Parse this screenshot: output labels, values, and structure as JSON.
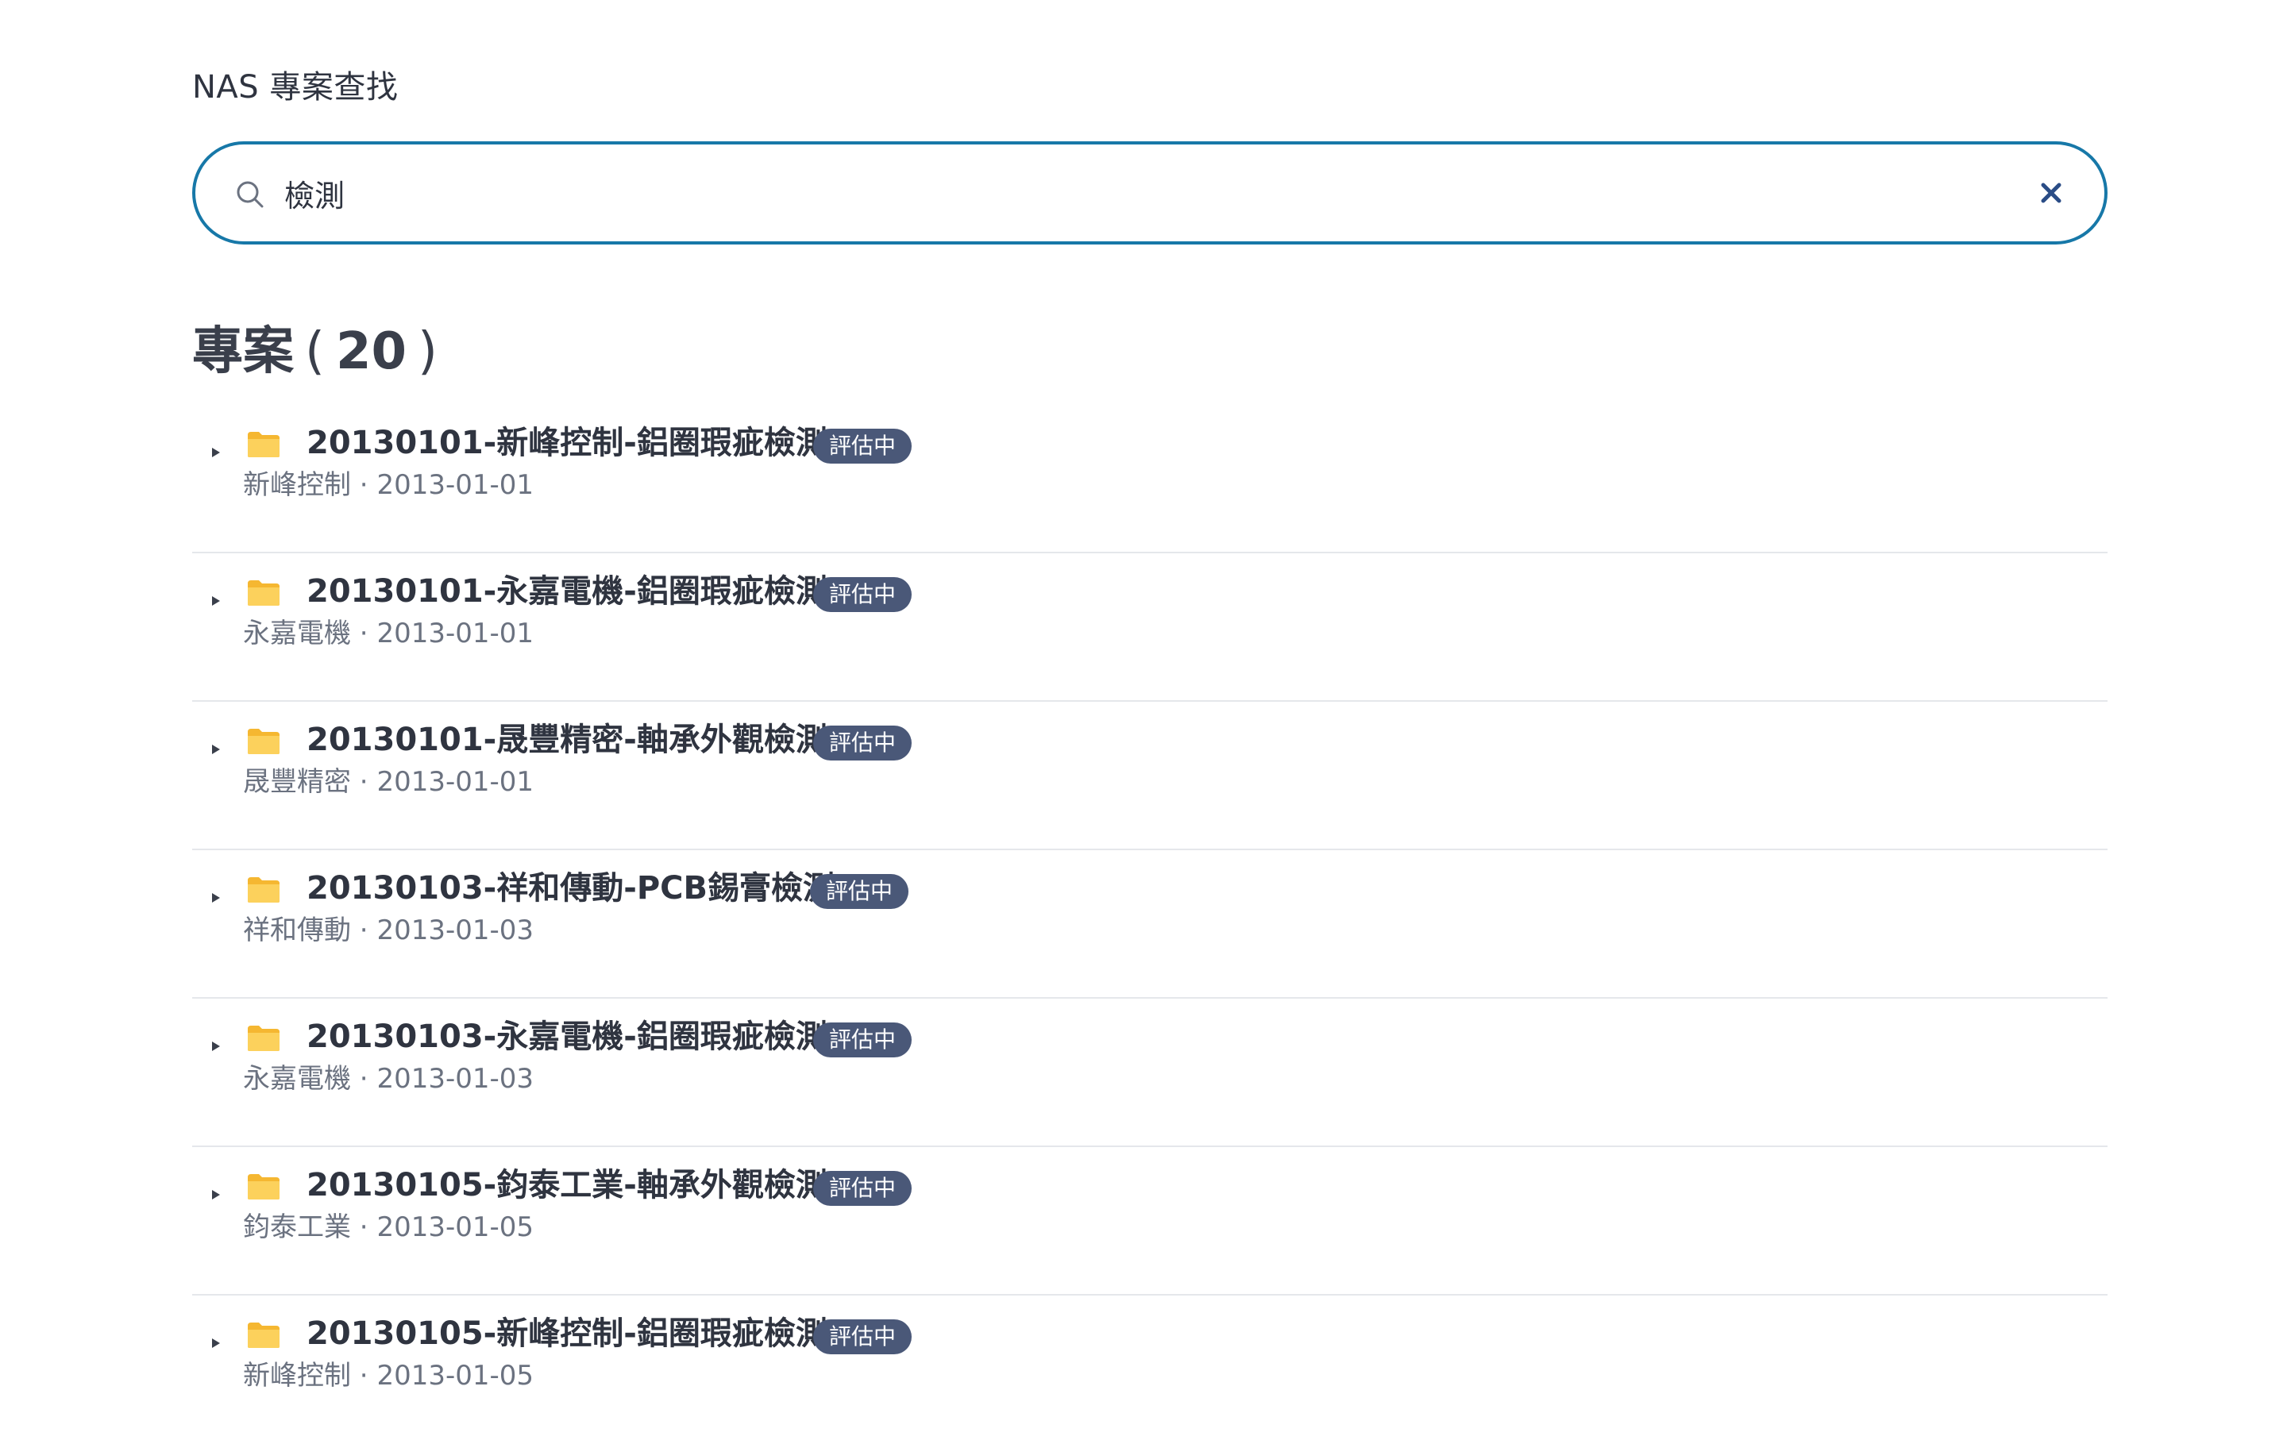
{
  "app": {
    "title": "NAS 專案查找"
  },
  "search": {
    "value": "檢測"
  },
  "results": {
    "label": "專案",
    "count": "20"
  },
  "projects": [
    {
      "title": "20130101-新峰控制-鋁圈瑕疵檢測",
      "status": "評估中",
      "client": "新峰控制",
      "date": "2013-01-01"
    },
    {
      "title": "20130101-永嘉電機-鋁圈瑕疵檢測",
      "status": "評估中",
      "client": "永嘉電機",
      "date": "2013-01-01"
    },
    {
      "title": "20130101-晟豐精密-軸承外觀檢測",
      "status": "評估中",
      "client": "晟豐精密",
      "date": "2013-01-01"
    },
    {
      "title": "20130103-祥和傳動-PCB錫膏檢測",
      "status": "評估中",
      "client": "祥和傳動",
      "date": "2013-01-03"
    },
    {
      "title": "20130103-永嘉電機-鋁圈瑕疵檢測",
      "status": "評估中",
      "client": "永嘉電機",
      "date": "2013-01-03"
    },
    {
      "title": "20130105-鈞泰工業-軸承外觀檢測",
      "status": "評估中",
      "client": "鈞泰工業",
      "date": "2013-01-05"
    },
    {
      "title": "20130105-新峰控制-鋁圈瑕疵檢測",
      "status": "評估中",
      "client": "新峰控制",
      "date": "2013-01-05"
    }
  ],
  "icons": {
    "search": "search-icon",
    "clear": "close-icon",
    "expand": "caret-right-icon",
    "folder": "folder-icon"
  },
  "colors": {
    "accent": "#1778a8",
    "badge": "#4a5878",
    "folder": "#f7c14a"
  }
}
